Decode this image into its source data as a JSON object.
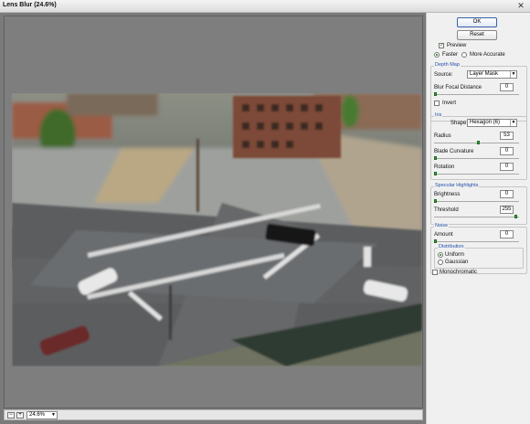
{
  "window": {
    "title": "Lens Blur (24.6%)",
    "close_glyph": "✕"
  },
  "footer": {
    "zoom": "24.6%",
    "zoom_out": "−",
    "zoom_in": "+"
  },
  "buttons": {
    "ok": "OK",
    "reset": "Reset"
  },
  "preview": {
    "label": "Preview",
    "checked": true,
    "faster": "Faster",
    "more_accurate": "More Accurate",
    "selected": "Faster"
  },
  "depth_map": {
    "title": "Depth Map",
    "source_label": "Source:",
    "source_value": "Layer Mask",
    "focal_label": "Blur Focal Distance",
    "focal_value": "0",
    "focal_slider": 0,
    "invert_label": "Invert",
    "invert_checked": false
  },
  "iris": {
    "title": "Iris",
    "shape_label": "Shape:",
    "shape_value": "Hexagon (6)",
    "radius_label": "Radius",
    "radius_value": "53",
    "radius_slider": 0.53,
    "curvature_label": "Blade Curvature",
    "curvature_value": "0",
    "curvature_slider": 0,
    "rotation_label": "Rotation",
    "rotation_value": "0",
    "rotation_slider": 0
  },
  "specular": {
    "title": "Specular Highlights",
    "brightness_label": "Brightness",
    "brightness_value": "0",
    "brightness_slider": 0,
    "threshold_label": "Threshold",
    "threshold_value": "255",
    "threshold_slider": 1
  },
  "noise": {
    "title": "Noise",
    "amount_label": "Amount",
    "amount_value": "0",
    "amount_slider": 0,
    "distribution_title": "Distribution",
    "uniform": "Uniform",
    "gaussian": "Gaussian",
    "selected": "Uniform",
    "monochromatic_label": "Monochromatic",
    "monochromatic_checked": false
  },
  "colors": {
    "accent": "#2350a8",
    "slider_thumb": "#3aa23a",
    "check": "#1a7a1a"
  }
}
